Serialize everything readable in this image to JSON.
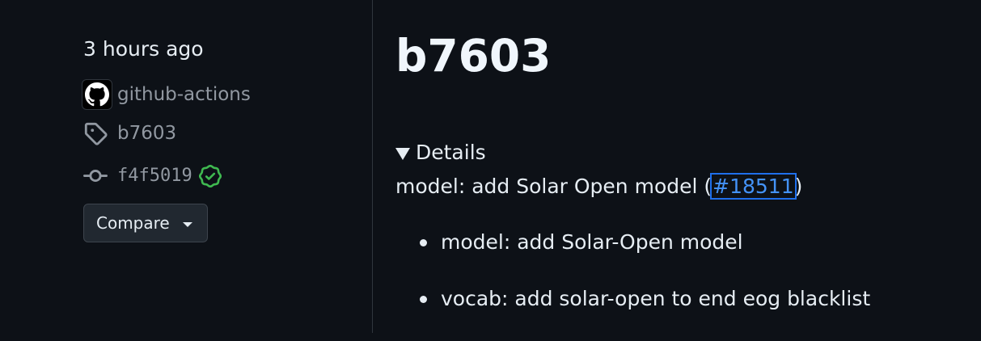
{
  "sidebar": {
    "time_ago": "3 hours ago",
    "author": "github-actions",
    "tag": "b7603",
    "commit": "f4f5019",
    "compare_label": "Compare",
    "icons": {
      "avatar": "github-mark-icon",
      "tag": "tag-icon",
      "commit": "git-commit-icon",
      "verified": "verified-check-icon",
      "compare_caret": "triangle-down-icon"
    },
    "colors": {
      "verified": "#3fb950",
      "muted": "#9198a1"
    }
  },
  "release": {
    "title": "b7603",
    "details_label": "Details",
    "commit_message_prefix": "model: add Solar Open model (",
    "pr_link": "#18511",
    "commit_message_suffix": ")",
    "bullets": [
      "model: add Solar-Open model",
      "vocab: add solar-open to end eog blacklist"
    ],
    "colors": {
      "link": "#4493f8",
      "background": "#0d1117",
      "text": "#e6edf3"
    }
  }
}
